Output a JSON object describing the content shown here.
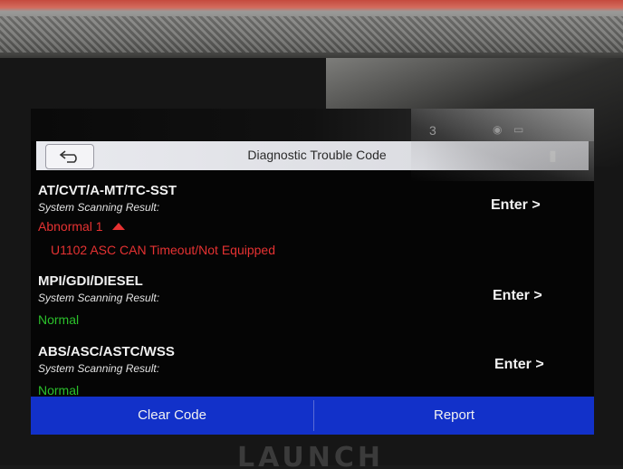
{
  "header": {
    "title": "Diagnostic Trouble Code",
    "time": "3",
    "back_icon": "back-arrow-icon"
  },
  "modules": [
    {
      "name": "AT/CVT/A-MT/TC-SST",
      "result_label": "System Scanning Result:",
      "status": "Abnormal 1",
      "status_color": "#e63232",
      "dtc": "U1102 ASC CAN Timeout/Not Equipped",
      "enter_label": "Enter >"
    },
    {
      "name": "MPI/GDI/DIESEL",
      "result_label": "System Scanning Result:",
      "status": "Normal",
      "status_color": "#2bc02b",
      "enter_label": "Enter >"
    },
    {
      "name": "ABS/ASC/ASTC/WSS",
      "result_label": "System Scanning Result:",
      "status": "Normal",
      "status_color": "#2bc02b",
      "enter_label": "Enter >"
    }
  ],
  "footer": {
    "clear_label": "Clear Code",
    "report_label": "Report",
    "bar_color": "#1231c9"
  },
  "device": {
    "brand": "LAUNCH"
  }
}
